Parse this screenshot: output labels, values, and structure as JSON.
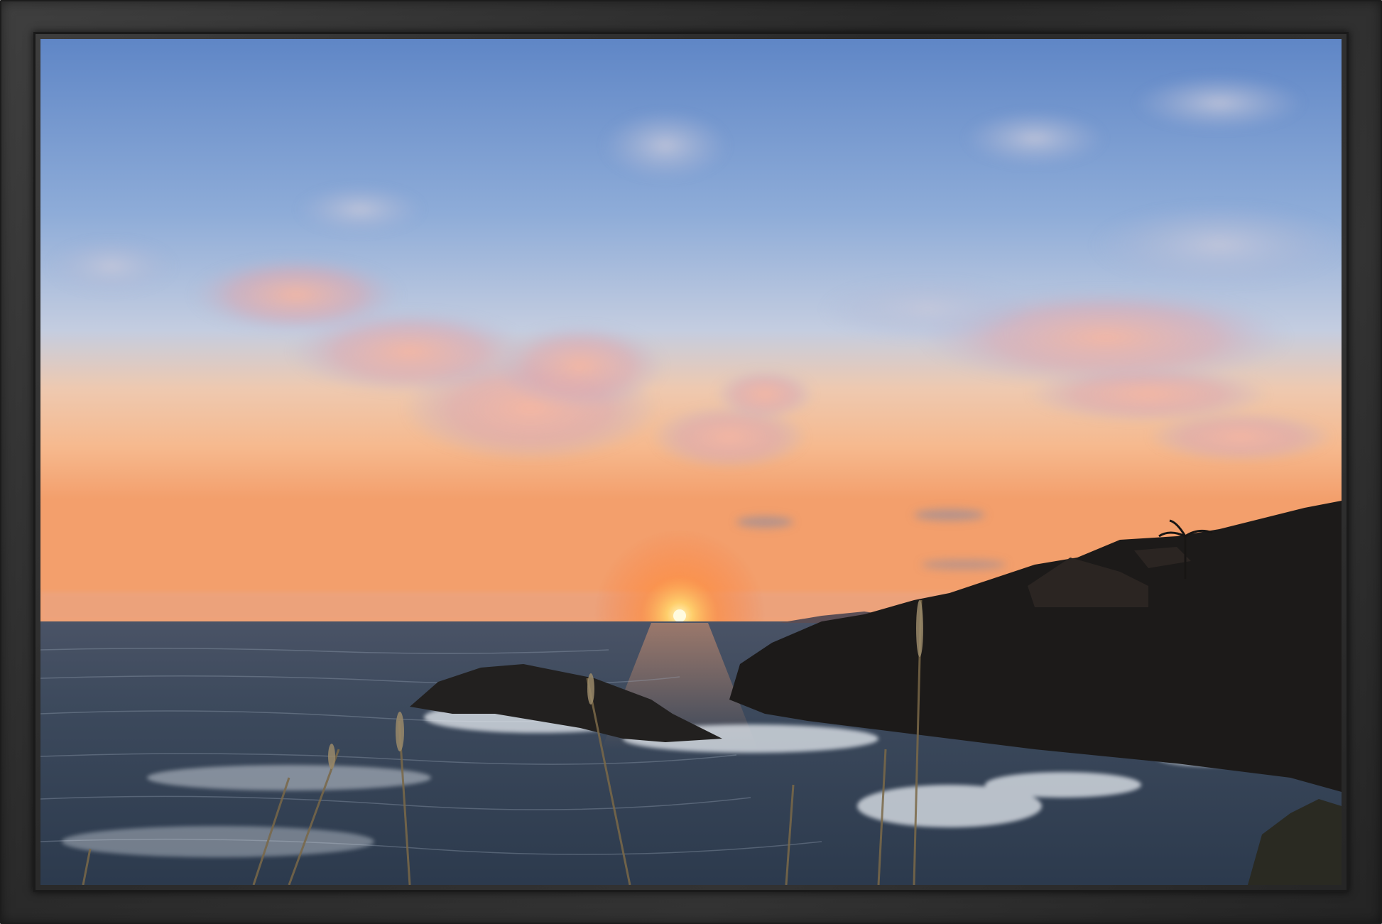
{
  "image": {
    "subject": "coastal sunset",
    "frame_color": "#2f2f2f",
    "colors": {
      "sky_top": "#6f93cf",
      "sky_mid": "#a9bfe0",
      "horizon_glow": "#f3a978",
      "sun": "#fff3b0",
      "sea": "#3a4a5e",
      "rocks": "#1f1b1a",
      "foam": "#e9edf2"
    }
  }
}
